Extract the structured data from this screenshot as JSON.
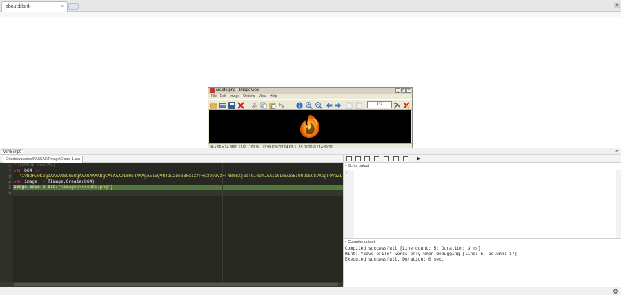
{
  "browser": {
    "tab_title": "about:blank",
    "tab_close": "×",
    "window_close": "×"
  },
  "imageview": {
    "title": "create.png - ImageView",
    "min": "_",
    "max": "□",
    "close": "×",
    "menu": [
      "File",
      "Edit",
      "Image",
      "Options",
      "View",
      "Help"
    ],
    "toolbar_icons": [
      "open-icon",
      "scan-icon",
      "save-icon",
      "delete-icon",
      "cut-icon",
      "copy-icon",
      "paste-icon",
      "undo-icon",
      "info-icon",
      "zoom-in-icon",
      "zoom-out-icon",
      "prev-icon",
      "next-icon",
      "first-page-icon",
      "last-page-icon",
      "settings-icon",
      "exit-icon"
    ],
    "page_field": "1/2",
    "status": [
      "96 x 96 x 24 BPP",
      "1/2",
      "100 %",
      "7.99 KB / 27.04 KB",
      "15.03.2015 / 14:39:32"
    ]
  },
  "wascript": {
    "panel_tab": "WAScript",
    "close": "×",
    "file_tab": "E:\\tests\\wascripts\\PASCAL\\TImage\\Create-1.pas",
    "lines": [
      {
        "n": "1",
        "parts": [
          {
            "t": "//{$MODE PASCAL}",
            "c": "#75715e"
          }
        ]
      },
      {
        "n": "2",
        "parts": [
          {
            "t": "var",
            "c": "#f92672"
          },
          {
            "t": " b64 ",
            "c": "#f8f8f2"
          },
          {
            "t": ":=",
            "c": "#f92672"
          }
        ]
      },
      {
        "n": "3",
        "parts": [
          {
            "t": "  'iVBORw0KGgoAAAANSUhEUgAAAGAAAABgCAYAAADimHc4AAAgAElEQVR42u2debBkdIXfP+d3by9v3+FN8mbXjGaTGI02hJAAIc0LmwUoBIOUDcEUSVXsgFOVpZL",
            "c": "#e6db74"
          }
        ]
      },
      {
        "n": "4",
        "parts": [
          {
            "t": "var",
            "c": "#f92672"
          },
          {
            "t": " image ",
            "c": "#f8f8f2"
          },
          {
            "t": ":=",
            "c": "#f92672"
          },
          {
            "t": " TImage.Create(b64)",
            "c": "#f8f8f2"
          }
        ]
      },
      {
        "n": "5",
        "parts": [
          {
            "t": "image.SaveToFile(",
            "c": "#ffffff"
          },
          {
            "t": "'\\images\\create.png'",
            "c": "#e6db74"
          },
          {
            "t": ")",
            "c": "#ffffff"
          }
        ]
      },
      {
        "n": "6",
        "parts": []
      }
    ],
    "script_output_label": "Script output",
    "script_output_lines": [
      "1"
    ],
    "compiler_output_label": "Compiler output",
    "compiler_lines": [
      "Compiled successfull [Line count: 5; Duration: 3 ms]",
      "Hint: \"SaveToFile\" works only when debugging [line: 5, column: 17]",
      "Executed successfull. Duration: 0 sec."
    ],
    "pane_toggle": "▾",
    "play": "▶"
  }
}
